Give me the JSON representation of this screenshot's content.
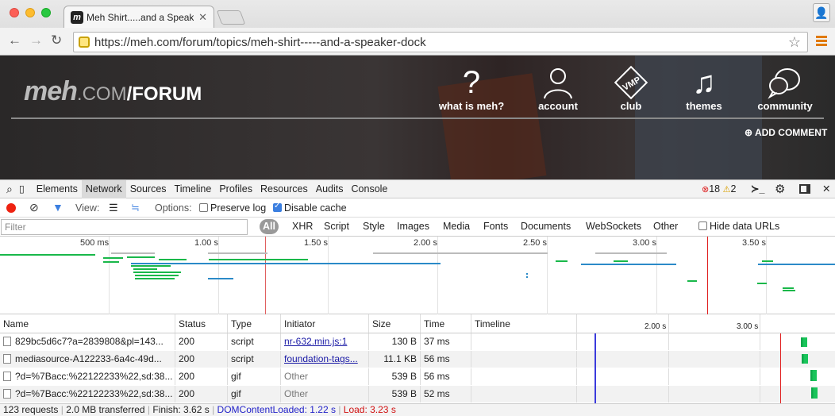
{
  "browser": {
    "tab_title": "Meh Shirt.....and a Speaker",
    "url": "https://meh.com/forum/topics/meh-shirt-----and-a-speaker-dock"
  },
  "site": {
    "logo_meh": "meh",
    "logo_com": ".COM",
    "logo_forum": "/FORUM",
    "nav": [
      {
        "label": "what is meh?",
        "icon": "question-icon"
      },
      {
        "label": "account",
        "icon": "person-icon"
      },
      {
        "label": "club",
        "icon": "vmp-icon"
      },
      {
        "label": "themes",
        "icon": "music-note-icon"
      },
      {
        "label": "community",
        "icon": "chat-bubbles-icon"
      }
    ],
    "add_comment": "ADD COMMENT"
  },
  "devtools": {
    "tabs": [
      "Elements",
      "Network",
      "Sources",
      "Timeline",
      "Profiles",
      "Resources",
      "Audits",
      "Console"
    ],
    "active_tab": "Network",
    "errors": "18",
    "warnings": "2",
    "view_label": "View:",
    "options_label": "Options:",
    "preserve_log": "Preserve log",
    "disable_cache": "Disable cache",
    "filter_placeholder": "Filter",
    "filter_all": "All",
    "filter_types": [
      "XHR",
      "Script",
      "Style",
      "Images",
      "Media",
      "Fonts",
      "Documents",
      "WebSockets",
      "Other"
    ],
    "hide_data_urls": "Hide data URLs",
    "overview_ticks": [
      "500 ms",
      "1.00 s",
      "1.50 s",
      "2.00 s",
      "2.50 s",
      "3.00 s",
      "3.50 s"
    ],
    "columns": [
      "Name",
      "Status",
      "Type",
      "Initiator",
      "Size",
      "Time",
      "Timeline"
    ],
    "timeline_ticks": [
      "2.00 s",
      "3.00 s"
    ],
    "rows": [
      {
        "name": "829bc5d6c7?a=2839808&pl=143...",
        "status": "200",
        "type": "script",
        "initiator": "nr-632.min.js:1",
        "initiator_link": true,
        "size": "130 B",
        "time": "37 ms"
      },
      {
        "name": "mediasource-A122233-6a4c-49d...",
        "status": "200",
        "type": "script",
        "initiator": "foundation-tags...",
        "initiator_link": true,
        "size": "11.1 KB",
        "time": "56 ms"
      },
      {
        "name": "?d=%7Bacc:%22122233%22,sd:38...",
        "status": "200",
        "type": "gif",
        "initiator": "Other",
        "initiator_link": false,
        "size": "539 B",
        "time": "56 ms"
      },
      {
        "name": "?d=%7Bacc:%22122233%22,sd:38...",
        "status": "200",
        "type": "gif",
        "initiator": "Other",
        "initiator_link": false,
        "size": "539 B",
        "time": "52 ms"
      }
    ],
    "status": {
      "requests": "123 requests",
      "transferred": "2.0 MB transferred",
      "finish": "Finish: 3.62 s",
      "dom": "DOMContentLoaded: 1.22 s",
      "load": "Load: 3.23 s"
    }
  },
  "colors": {
    "dom_line": "#3b3bdc",
    "load_line": "#e02020",
    "bar_green": "#19b84a",
    "bar_blue": "#2b8ac8"
  }
}
